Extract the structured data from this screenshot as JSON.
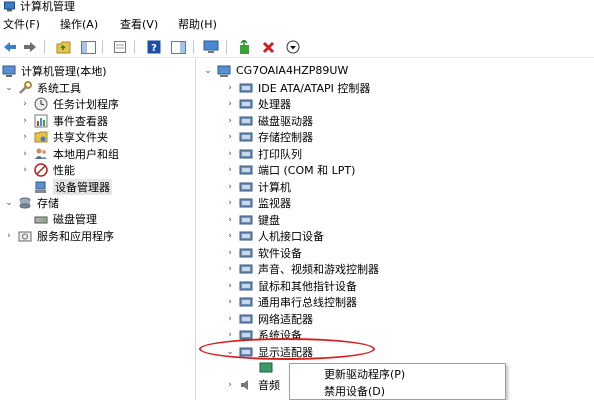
{
  "window": {
    "title": "计算机管理"
  },
  "menu": [
    "文件(F)",
    "操作(A)",
    "查看(V)",
    "帮助(H)"
  ],
  "toolbar": {
    "buttons": [
      "back-icon",
      "forward-icon",
      "up-folder-icon",
      "show-hide-tree-icon",
      "properties-icon",
      "help-icon",
      "action-pane-icon",
      "monitor-icon",
      "update-driver-icon",
      "uninstall-icon",
      "download-icon"
    ]
  },
  "left_tree": [
    {
      "label": "计算机管理(本地)",
      "icon": "computer-mgmt-icon"
    },
    {
      "label": "系统工具",
      "icon": "tools-icon"
    },
    {
      "label": "任务计划程序",
      "icon": "clock-icon"
    },
    {
      "label": "事件查看器",
      "icon": "event-viewer-icon"
    },
    {
      "label": "共享文件夹",
      "icon": "shared-folder-icon"
    },
    {
      "label": "本地用户和组",
      "icon": "users-icon"
    },
    {
      "label": "性能",
      "icon": "performance-icon"
    },
    {
      "label": "设备管理器",
      "icon": "device-manager-icon"
    },
    {
      "label": "存储",
      "icon": "storage-icon"
    },
    {
      "label": "磁盘管理",
      "icon": "disk-icon"
    },
    {
      "label": "服务和应用程序",
      "icon": "services-icon"
    }
  ],
  "right_tree": {
    "root": "CG7OAIA4HZP89UW",
    "categories": [
      "IDE ATA/ATAPI 控制器",
      "处理器",
      "磁盘驱动器",
      "存储控制器",
      "打印队列",
      "端口 (COM 和 LPT)",
      "计算机",
      "监视器",
      "键盘",
      "人机接口设备",
      "软件设备",
      "声音、视频和游戏控制器",
      "鼠标和其他指针设备",
      "通用串行总线控制器",
      "网络适配器",
      "系统设备",
      "显示适配器"
    ],
    "partial_item": "音频"
  },
  "context_menu": {
    "items": [
      "更新驱动程序(P)",
      "禁用设备(D)"
    ]
  },
  "colors": {
    "annotation": "#d62020",
    "selected_bg": "#e5e5e5"
  }
}
